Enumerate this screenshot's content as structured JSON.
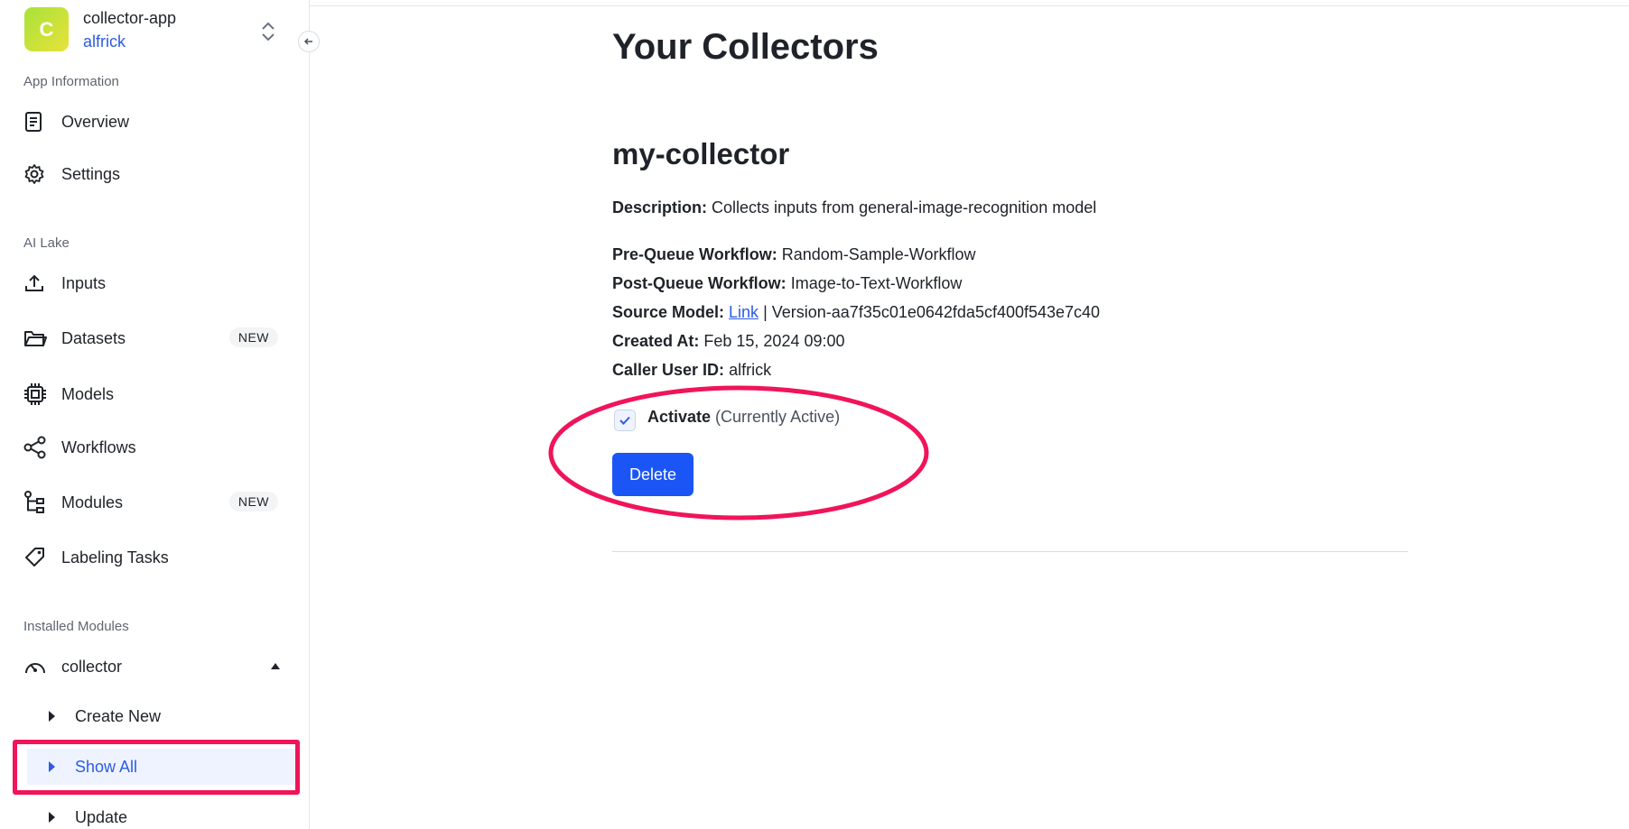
{
  "app": {
    "avatar_letter": "C",
    "name": "collector-app",
    "user": "alfrick"
  },
  "sidebar": {
    "sections": {
      "app_information": "App Information",
      "ai_lake": "AI Lake",
      "installed_modules": "Installed Modules"
    },
    "items": [
      {
        "label": "Overview",
        "icon": "document-icon"
      },
      {
        "label": "Settings",
        "icon": "gear-icon"
      },
      {
        "label": "Inputs",
        "icon": "upload-icon"
      },
      {
        "label": "Datasets",
        "icon": "folder-icon",
        "badge": "NEW"
      },
      {
        "label": "Models",
        "icon": "chip-icon"
      },
      {
        "label": "Workflows",
        "icon": "share-nodes-icon"
      },
      {
        "label": "Modules",
        "icon": "branch-icon",
        "badge": "NEW"
      },
      {
        "label": "Labeling Tasks",
        "icon": "tag-icon"
      }
    ],
    "module": {
      "label": "collector",
      "icon": "gauge-icon"
    },
    "sub_items": [
      {
        "label": "Create New"
      },
      {
        "label": "Show All",
        "active": true
      },
      {
        "label": "Update"
      }
    ]
  },
  "main": {
    "title": "Your Collectors",
    "collector": {
      "name": "my-collector",
      "description_label": "Description:",
      "description": "Collects inputs from general-image-recognition model",
      "pre_queue_label": "Pre-Queue Workflow:",
      "pre_queue": "Random-Sample-Workflow",
      "post_queue_label": "Post-Queue Workflow:",
      "post_queue": "Image-to-Text-Workflow",
      "source_model_label": "Source Model:",
      "source_model_link": "Link",
      "source_model_version": "| Version-aa7f35c01e0642fda5cf400f543e7c40",
      "created_at_label": "Created At:",
      "created_at": "Feb 15, 2024 09:00",
      "caller_label": "Caller User ID:",
      "caller": "alfrick",
      "activate_label": "Activate",
      "activate_status": "(Currently Active)",
      "activate_checked": true,
      "delete_label": "Delete"
    }
  },
  "colors": {
    "accent": "#2d5be3",
    "delete_button": "#1b55f5",
    "annotation": "#f0145a",
    "active_bg": "#eef3ff"
  }
}
